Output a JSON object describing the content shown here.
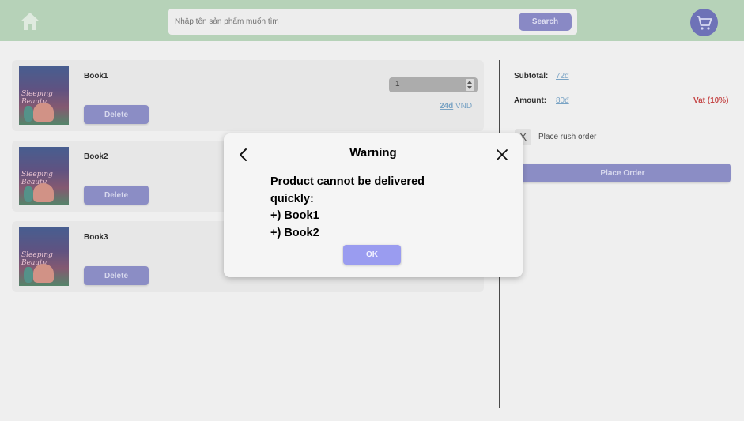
{
  "header": {
    "search_placeholder": "Nhập tên sản phẩm muốn tìm",
    "search_button": "Search"
  },
  "cart": {
    "items": [
      {
        "name": "Book1",
        "cover_text": "Sleeping Beauty",
        "quantity": "1",
        "price_amount": "24đ",
        "price_currency": "VND",
        "delete_label": "Delete"
      },
      {
        "name": "Book2",
        "cover_text": "Sleeping Beauty",
        "delete_label": "Delete"
      },
      {
        "name": "Book3",
        "cover_text": "Sleeping Beauty",
        "delete_label": "Delete"
      }
    ]
  },
  "summary": {
    "subtotal_label": "Subtotal:",
    "subtotal_value": "72đ",
    "amount_label": "Amount:",
    "amount_value": "80đ",
    "vat_label": "Vat (10%)",
    "rush_checkbox_mark": "X",
    "rush_label": "Place rush order",
    "place_order_label": "Place Order"
  },
  "modal": {
    "title": "Warning",
    "message_line1": "Product cannot be delivered",
    "message_line2": "quickly:",
    "message_line3": "+) Book1",
    "message_line4": "+) Book2",
    "ok_label": "OK"
  },
  "colors": {
    "header_bg": "#a7c9a9",
    "accent": "#7274b9",
    "cart_button": "#4f53a8",
    "vat_red": "#b92020",
    "link_blue": "#5c8fb8",
    "ok_button": "#9a9cf0"
  }
}
